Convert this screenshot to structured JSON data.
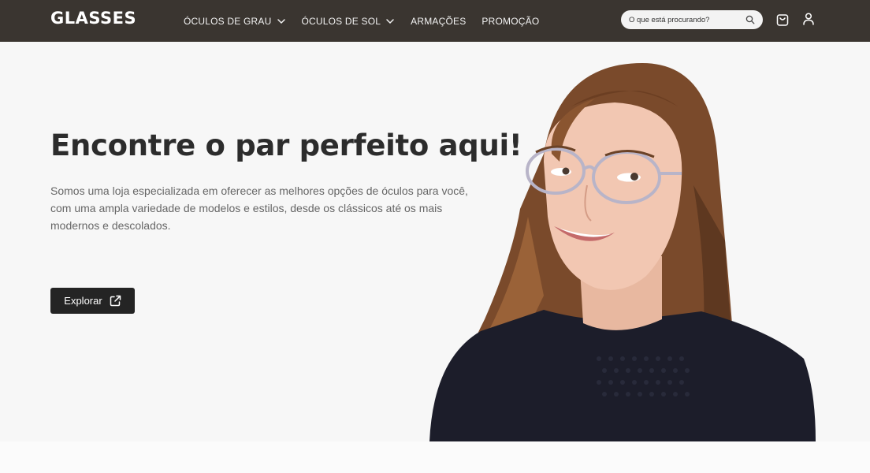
{
  "brand": {
    "logo": "GLASSES"
  },
  "nav": {
    "items": [
      {
        "label": "ÓCULOS DE GRAU",
        "has_dropdown": true
      },
      {
        "label": "ÓCULOS DE SOL",
        "has_dropdown": true
      },
      {
        "label": "ARMAÇÕES",
        "has_dropdown": false
      },
      {
        "label": "PROMOÇÃO",
        "has_dropdown": false
      }
    ]
  },
  "search": {
    "placeholder": "O que está procurando?",
    "icon": "search-icon"
  },
  "header_icons": {
    "cart": "shopping-bag-icon",
    "account": "user-icon"
  },
  "hero": {
    "title": "Encontre o par perfeito aqui!",
    "description": "Somos uma loja especializada em oferecer as melhores opções de óculos para você, com uma ampla variedade de modelos e estilos, desde os clássicos até os mais modernos e descolados.",
    "cta_label": "Explorar",
    "cta_icon": "external-link-icon",
    "image": "woman-wearing-glasses-photo"
  },
  "colors": {
    "header_bg": "#3a3530",
    "hero_bg": "#f7f7f7",
    "button_bg": "#242424",
    "title": "#2c2c2c"
  }
}
